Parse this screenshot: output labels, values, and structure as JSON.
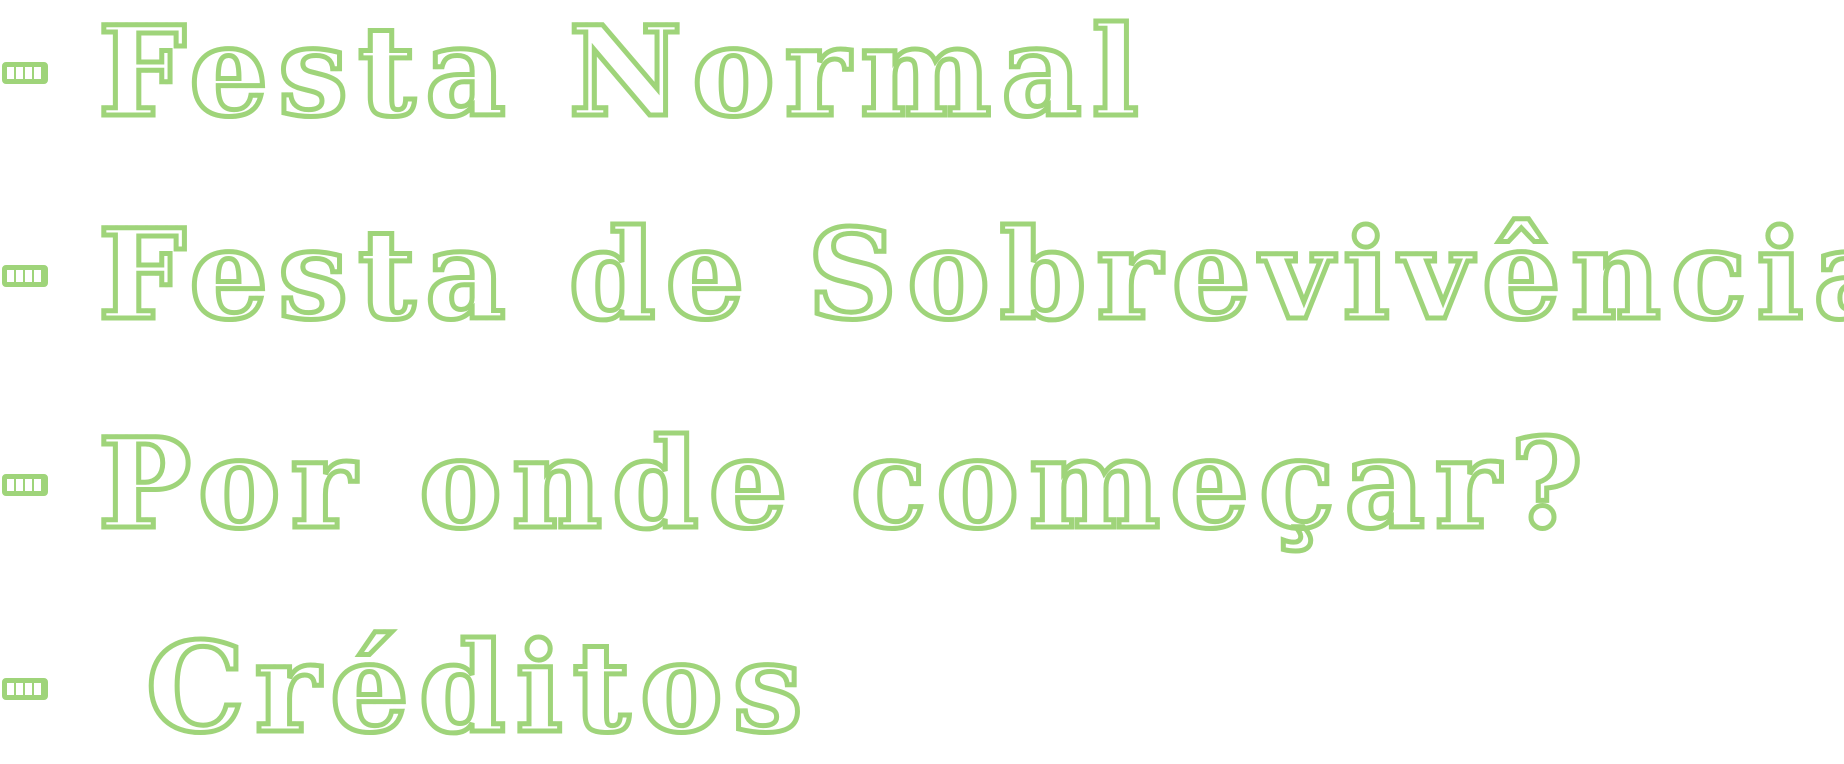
{
  "menu": {
    "items": [
      {
        "bullet": "-",
        "label": "Festa Normal"
      },
      {
        "bullet": "-",
        "label": "Festa de Sobrevivência"
      },
      {
        "bullet": "-",
        "label": "Por onde começar?"
      },
      {
        "bullet": "-",
        "label": "Créditos"
      }
    ]
  },
  "colors": {
    "outline": "#9fd47a",
    "fill": "#ffffff",
    "background": "#ffffff"
  }
}
